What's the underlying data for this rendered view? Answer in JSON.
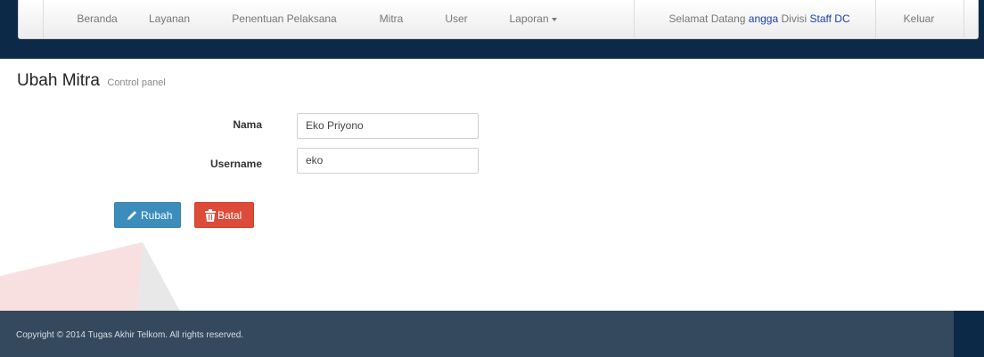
{
  "nav": {
    "items": [
      {
        "label": "Beranda"
      },
      {
        "label": "Layanan"
      },
      {
        "label": "Penentuan Pelaksana"
      },
      {
        "label": "Mitra"
      },
      {
        "label": "User"
      },
      {
        "label": "Laporan"
      }
    ],
    "welcome_prefix": "Selamat Datang",
    "username": "angga",
    "division_prefix": "Divisi",
    "division": "Staff DC",
    "logout": "Keluar"
  },
  "page": {
    "title": "Ubah Mitra",
    "subtitle": "Control panel"
  },
  "form": {
    "nama_label": "Nama",
    "nama_value": "Eko Priyono",
    "username_label": "Username",
    "username_value": "eko"
  },
  "actions": {
    "save": "Rubah",
    "cancel": "Batal"
  },
  "footer": {
    "copyright": "Copyright © 2014 Tugas Akhir Telkom. All rights reserved."
  },
  "colors": {
    "navbar_dark": "#0c2a48",
    "footer": "#34495e",
    "save_button": "#3c8dbc",
    "cancel_button": "#dd4b39",
    "highlight_text": "#1a3fb0"
  },
  "icons": {
    "save": "pencil-icon",
    "cancel": "trash-icon",
    "dropdown": "caret-down-icon"
  }
}
